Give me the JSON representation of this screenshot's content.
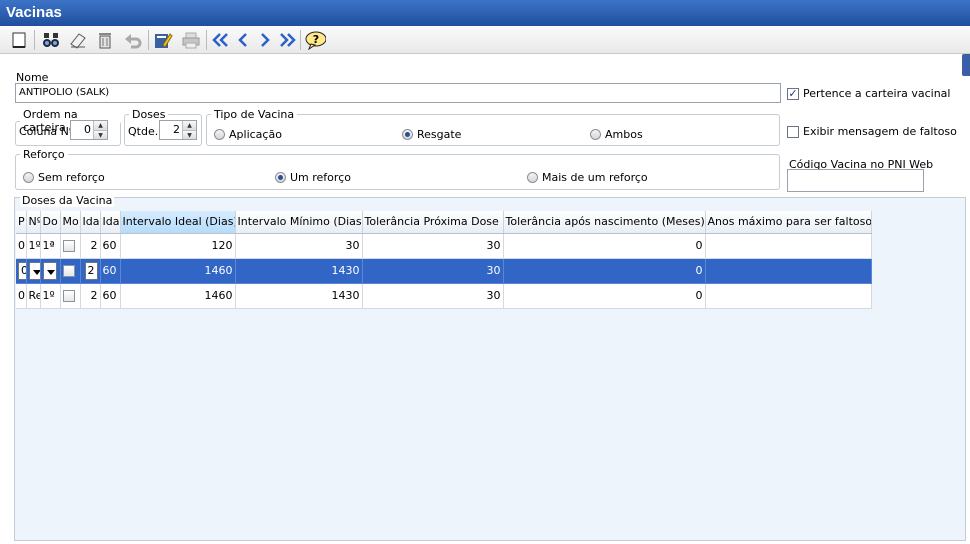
{
  "window": {
    "title": "Vacinas"
  },
  "toolbar": {
    "items": [
      "new-icon",
      "search-icon",
      "clear-icon",
      "delete-icon",
      "undo-icon",
      "edit-icon",
      "print-icon",
      "first-icon",
      "previous-icon",
      "next-icon",
      "last-icon",
      "help-icon"
    ]
  },
  "form": {
    "nome_label": "Nome",
    "nome_value": "ANTIPOLIO (SALK)",
    "pertence_label": "Pertence a carteira vacinal",
    "pertence_checked": true,
    "ordem": {
      "legend": "Ordem na carteira",
      "coluna_label": "Coluna Nº",
      "coluna_value": "0"
    },
    "doses": {
      "legend": "Doses",
      "qtde_label": "Qtde.",
      "qtde_value": "2"
    },
    "tipo": {
      "legend": "Tipo de Vacina",
      "options": [
        "Aplicação",
        "Resgate",
        "Ambos"
      ],
      "selected": "Resgate"
    },
    "exibir_label": "Exibir mensagem de faltoso",
    "exibir_checked": false,
    "reforco": {
      "legend": "Reforço",
      "options": [
        "Sem reforço",
        "Um reforço",
        "Mais de um reforço"
      ],
      "selected": "Um reforço"
    },
    "codigo_label": "Código Vacina no PNI Web",
    "codigo_value": ""
  },
  "doses_table": {
    "legend": "Doses da Vacina",
    "headers": [
      "P",
      "Nº",
      "Do",
      "Mo",
      "Ida",
      "Ida",
      "Intervalo Ideal (Dias)",
      "Intervalo Mínimo (Dias)",
      "Tolerância Próxima Dose",
      "Tolerância após nascimento (Meses)",
      "Anos máximo para ser faltoso"
    ],
    "rows": [
      {
        "p": "0",
        "n": "1º",
        "do": "1ª",
        "ida1": "2",
        "ida2": "60",
        "ideal": "120",
        "minimo": "30",
        "tol_prox": "30",
        "tol_nasc": "0",
        "anos": ""
      },
      {
        "p": "0",
        "n": "",
        "do": "",
        "ida1": "2",
        "ida2": "60",
        "ideal": "1460",
        "minimo": "1430",
        "tol_prox": "30",
        "tol_nasc": "0",
        "anos": ""
      },
      {
        "p": "0",
        "n": "Re",
        "do": "1º",
        "ida1": "2",
        "ida2": "60",
        "ideal": "1460",
        "minimo": "1430",
        "tol_prox": "30",
        "tol_nasc": "0",
        "anos": ""
      }
    ]
  }
}
